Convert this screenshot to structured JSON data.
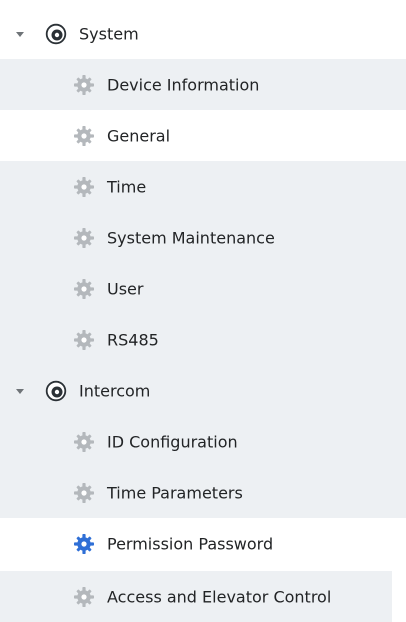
{
  "tree": {
    "system": {
      "label": "System",
      "icon": "system-icon",
      "children": [
        {
          "label": "Device Information",
          "icon": "gear-icon"
        },
        {
          "label": "General",
          "icon": "gear-icon"
        },
        {
          "label": "Time",
          "icon": "gear-icon"
        },
        {
          "label": "System Maintenance",
          "icon": "gear-icon"
        },
        {
          "label": "User",
          "icon": "gear-icon"
        },
        {
          "label": "RS485",
          "icon": "gear-icon"
        }
      ]
    },
    "intercom": {
      "label": "Intercom",
      "icon": "system-icon",
      "children": [
        {
          "label": "ID Configuration",
          "icon": "gear-icon"
        },
        {
          "label": "Time Parameters",
          "icon": "gear-icon"
        },
        {
          "label": "Permission Password",
          "icon": "gear-icon",
          "selected": true
        },
        {
          "label": "Access and Elevator Control",
          "icon": "gear-icon"
        }
      ]
    }
  },
  "colors": {
    "row_shade": "#edf0f3",
    "row_white": "#ffffff",
    "gear_gray": "#b4b8bc",
    "gear_blue": "#2f6fd6",
    "system_icon_dark": "#2b3136",
    "text": "#222426"
  }
}
